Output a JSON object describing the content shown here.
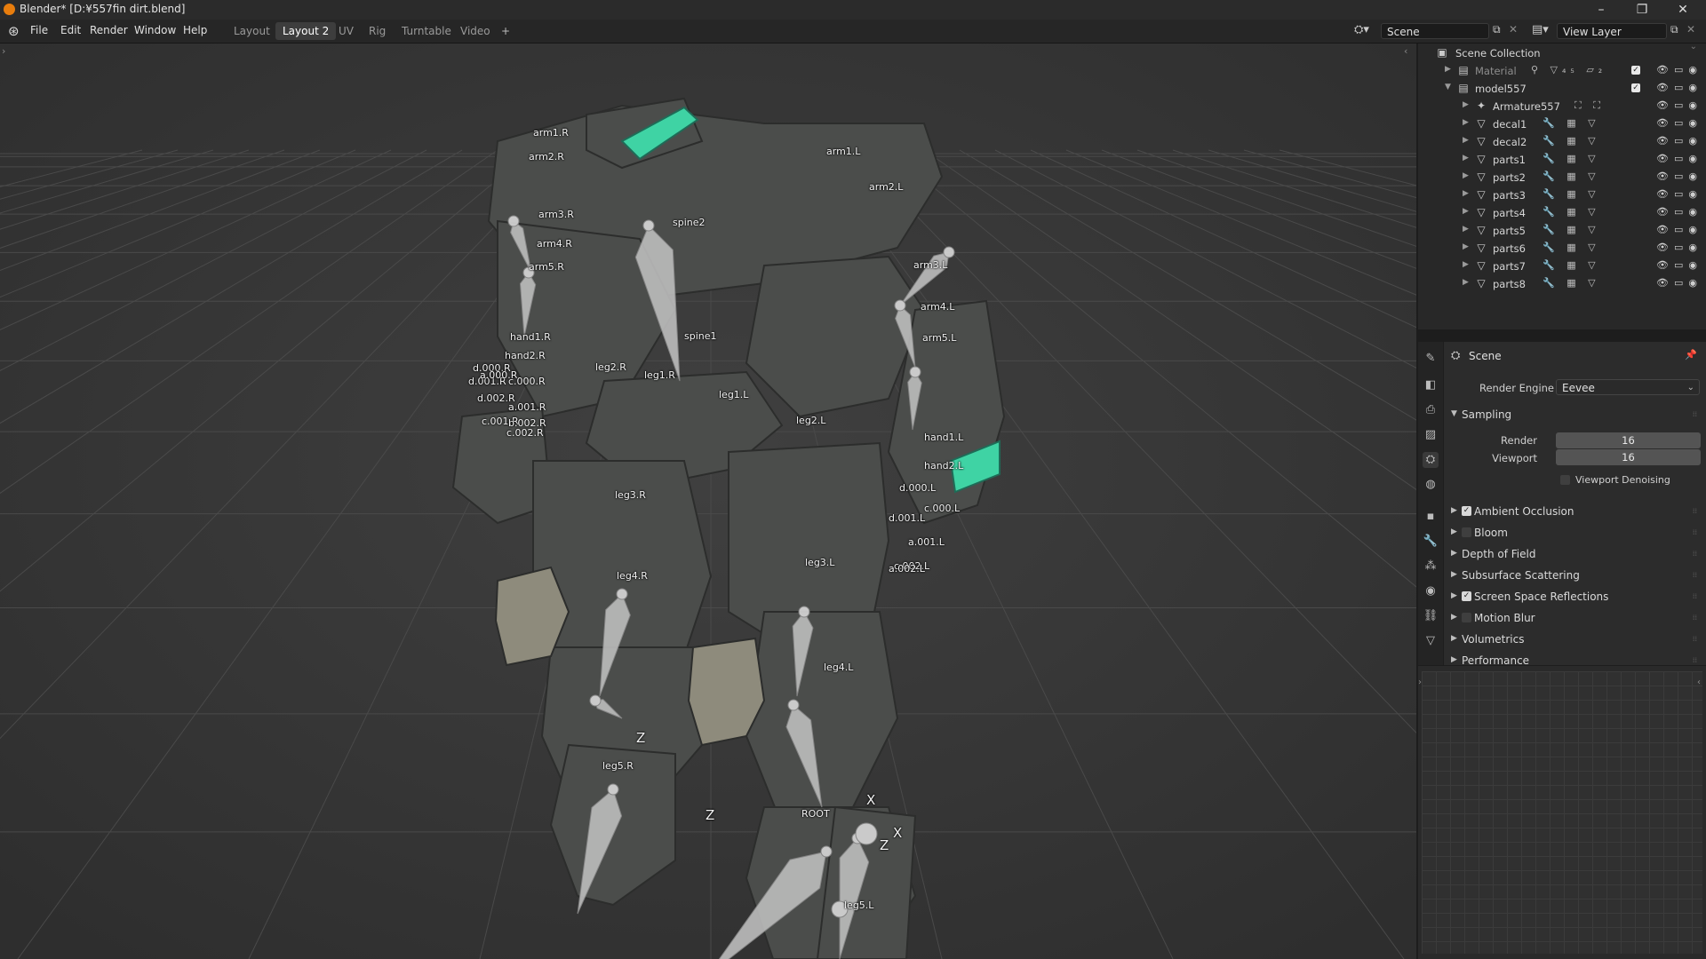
{
  "window": {
    "title": "Blender* [D:¥557fin dirt.blend]",
    "controls": {
      "minimize": "–",
      "restore": "❐",
      "close": "✕"
    }
  },
  "menu": {
    "items": [
      "File",
      "Edit",
      "Render",
      "Window",
      "Help"
    ]
  },
  "workspaces": {
    "tabs": [
      "Layout",
      "Layout 2",
      "UV",
      "Rig",
      "Turntable",
      "Video"
    ],
    "active": "Layout 2",
    "add": "+"
  },
  "topbar": {
    "scene": "Scene",
    "view_layer": "View Layer"
  },
  "viewport": {
    "bones": [
      "arm1.R",
      "arm2.R",
      "arm3.R",
      "arm4.R",
      "arm5.R",
      "spine2",
      "spine1",
      "arm1.L",
      "arm2.L",
      "arm3.L",
      "arm4.L",
      "arm5.L",
      "hand1.R",
      "hand2.R",
      "d.000.R",
      "d.001.R",
      "a.000.R",
      "c.000.R",
      "d.002.R",
      "a.001.R",
      "c.001.R",
      "b.002.R",
      "c.002.R",
      "leg2.R",
      "leg1.R",
      "leg1.L",
      "leg2.L",
      "hand1.L",
      "hand2.L",
      "d.000.L",
      "d.001.L",
      "c.000.L",
      "a.001.L",
      "c.002.L",
      "a.002.L",
      "leg3.R",
      "leg4.R",
      "leg3.L",
      "leg4.L",
      "leg5.R",
      "ROOT",
      "leg5.L"
    ],
    "axis_labels": [
      "Z",
      "X",
      "Z",
      "X",
      "Z"
    ]
  },
  "outliner": {
    "root": "Scene Collection",
    "rows": [
      {
        "name": "Material",
        "mods": "⚲ ▽₄₅ ▱₂"
      },
      {
        "name": "model557",
        "mods": ""
      },
      {
        "name": "Armature557",
        "mods": "⛶ ⛶"
      },
      {
        "name": "decal1",
        "mods": "🔧 ▦ ▽"
      },
      {
        "name": "decal2",
        "mods": "🔧 ▦ ▽"
      },
      {
        "name": "parts1",
        "mods": "🔧 ▦ ▽"
      },
      {
        "name": "parts2",
        "mods": "🔧 ▦ ▽"
      },
      {
        "name": "parts3",
        "mods": "🔧 ▦ ▽"
      },
      {
        "name": "parts4",
        "mods": "🔧 ▦ ▽"
      },
      {
        "name": "parts5",
        "mods": "🔧 ▦ ▽"
      },
      {
        "name": "parts6",
        "mods": "🔧 ▦ ▽"
      },
      {
        "name": "parts7",
        "mods": "🔧 ▦ ▽"
      },
      {
        "name": "parts8",
        "mods": "🔧 ▦ ▽"
      }
    ]
  },
  "properties": {
    "context": "Scene",
    "render_engine": {
      "label": "Render Engine",
      "value": "Eevee"
    },
    "sampling": {
      "title": "Sampling",
      "render_label": "Render",
      "render_value": "16",
      "viewport_label": "Viewport",
      "viewport_value": "16",
      "denoise_label": "Viewport Denoising"
    },
    "panels": [
      {
        "label": "Ambient Occlusion",
        "checkbox": true,
        "checked": true
      },
      {
        "label": "Bloom",
        "checkbox": true,
        "checked": false
      },
      {
        "label": "Depth of Field",
        "checkbox": false,
        "checked": false
      },
      {
        "label": "Subsurface Scattering",
        "checkbox": false,
        "checked": false
      },
      {
        "label": "Screen Space Reflections",
        "checkbox": true,
        "checked": true
      },
      {
        "label": "Motion Blur",
        "checkbox": true,
        "checked": false
      },
      {
        "label": "Volumetrics",
        "checkbox": false,
        "checked": false
      },
      {
        "label": "Performance",
        "checkbox": false,
        "checked": false
      }
    ]
  },
  "colors": {
    "accent_orange": "#e87d0d",
    "glow_green": "#3fd3a4",
    "bone": "#cfcfcf"
  }
}
